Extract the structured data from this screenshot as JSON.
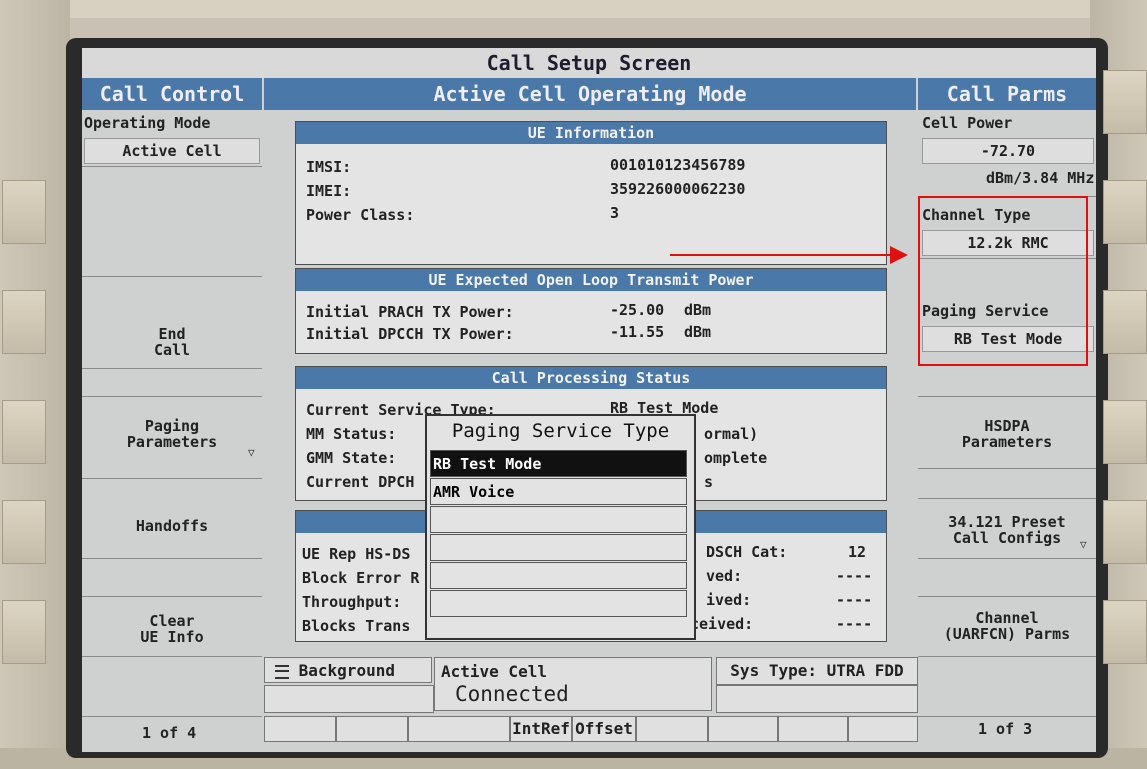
{
  "title": "Call Setup Screen",
  "left": {
    "header": "Call Control",
    "operating_mode_label": "Operating Mode",
    "operating_mode_value": "Active Cell",
    "end_call": [
      "End",
      "Call"
    ],
    "paging_parameters": [
      "Paging",
      "Parameters"
    ],
    "handoffs": "Handoffs",
    "clear_ue_info": [
      "Clear",
      "UE Info"
    ],
    "page": "1 of 4"
  },
  "center": {
    "header": "Active Cell Operating Mode",
    "ue_info": {
      "title": "UE Information",
      "rows": [
        {
          "label": "IMSI:",
          "value": "001010123456789"
        },
        {
          "label": "IMEI:",
          "value": "359226000062230"
        },
        {
          "label": "Power Class:",
          "value": "3"
        }
      ]
    },
    "power": {
      "title": "UE Expected Open Loop Transmit Power",
      "rows": [
        {
          "label": "Initial PRACH TX Power:",
          "value": "-25.00",
          "unit": "dBm"
        },
        {
          "label": "Initial DPCCH TX Power:",
          "value": "-11.55",
          "unit": "dBm"
        }
      ]
    },
    "cps": {
      "title": "Call Processing Status",
      "rows": [
        {
          "label": "Current Service Type:",
          "value": "RB Test Mode"
        },
        {
          "label": "MM Status:",
          "value": "ormal)"
        },
        {
          "label": "GMM State:",
          "value": "omplete"
        },
        {
          "label": "Current DPCH",
          "value": "s"
        }
      ]
    },
    "hs": {
      "rows": [
        {
          "label": "UE Rep HS-DS",
          "mid": "DSCH Cat:",
          "value": "12"
        },
        {
          "label": "Block Error R",
          "mid": "ved:",
          "value": "----"
        },
        {
          "label": "Throughput:",
          "mid": "ived:",
          "value": "----"
        },
        {
          "label": "Blocks Trans",
          "mid": "ceived:",
          "value": "----"
        }
      ]
    }
  },
  "popup": {
    "title": "Paging Service Type",
    "items": [
      "RB Test Mode",
      "AMR Voice",
      "",
      "",
      "",
      ""
    ],
    "selected": 0
  },
  "status": {
    "background": "Background",
    "cell_state": "Active Cell",
    "connection": "Connected",
    "sys_type": "Sys Type: UTRA FDD",
    "intref": "IntRef",
    "offset": "Offset"
  },
  "right": {
    "header": "Call Parms",
    "cell_power_label": "Cell Power",
    "cell_power_value": "-72.70",
    "cell_power_unit": "dBm/3.84 MHz",
    "channel_type_label": "Channel Type",
    "channel_type_value": "12.2k RMC",
    "paging_service_label": "Paging Service",
    "paging_service_value": "RB Test Mode",
    "hsdpa": [
      "HSDPA",
      "Parameters"
    ],
    "preset": [
      "34.121 Preset",
      "Call Configs"
    ],
    "channel": [
      "Channel",
      "(UARFCN) Parms"
    ],
    "page": "1 of 3"
  },
  "colors": {
    "header_blue": "#4a78a8",
    "annotation_red": "#e01010"
  }
}
